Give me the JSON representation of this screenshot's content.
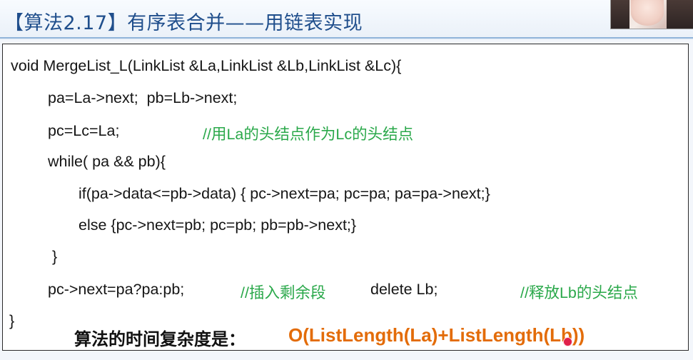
{
  "slide": {
    "title": "【算法2.17】有序表合并——用链表实现"
  },
  "code": {
    "line1": "void MergeList_L(LinkList &La,LinkList &Lb,LinkList &Lc){",
    "line2": "pa=La->next;  pb=Lb->next;",
    "line3": "pc=Lc=La;",
    "line3_comment": "//用La的头结点作为Lc的头结点",
    "line4": "while( pa && pb){",
    "line5": "if(pa->data<=pb->data) { pc->next=pa; pc=pa; pa=pa->next;}",
    "line6": "else {pc->next=pb; pc=pb; pb=pb->next;}",
    "line7": "}",
    "line8": "pc->next=pa?pa:pb;",
    "line8_comment": "//插入剩余段",
    "line8_b": "delete Lb;",
    "line8_b_comment": "//释放Lb的头结点",
    "line9": "}"
  },
  "complexity": {
    "label": "算法的时间复杂度是：",
    "value": "O(ListLength(La)+ListLength(Lb))"
  },
  "colors": {
    "title": "#1f4e8c",
    "comment": "#2aa84a",
    "complexity_value": "#e36c09",
    "cursor": "#e0204a"
  }
}
